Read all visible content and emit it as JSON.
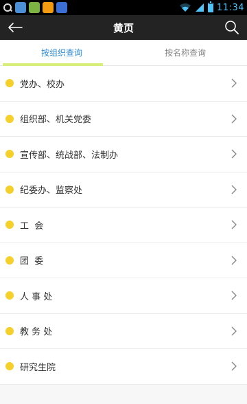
{
  "status_bar": {
    "time": "11:34",
    "battery_level": 0.9,
    "app_icons": [
      "#4b8fd6",
      "#7cb342",
      "#f39c12",
      "#3b6fd6"
    ]
  },
  "app_bar": {
    "title": "黄页"
  },
  "tabs": [
    {
      "label": "按组织查询",
      "active": true
    },
    {
      "label": "按名称查询",
      "active": false
    }
  ],
  "list": {
    "items": [
      {
        "label": "党办、校办"
      },
      {
        "label": "组织部、机关党委"
      },
      {
        "label": "宣传部、统战部、法制办"
      },
      {
        "label": "纪委办、监察处"
      },
      {
        "label": "工  会"
      },
      {
        "label": "团  委"
      },
      {
        "label": "人 事 处"
      },
      {
        "label": "教 务 处"
      },
      {
        "label": "研究生院"
      }
    ]
  },
  "colors": {
    "accent": "#2e8bd3",
    "tab_indicator": "#d7ef7a",
    "bullet": "#f5cf2a",
    "app_bar": "#232323"
  }
}
